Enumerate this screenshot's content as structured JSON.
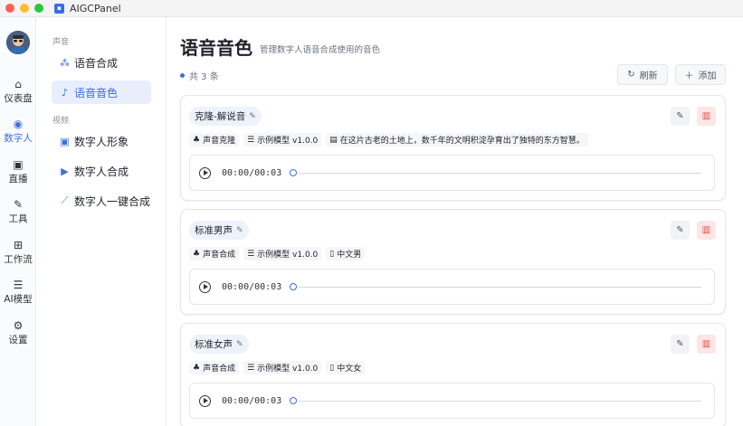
{
  "window": {
    "title": "AIGCPanel"
  },
  "rail": {
    "items": [
      {
        "label": "仪表盘",
        "icon": "home-icon"
      },
      {
        "label": "数字人",
        "icon": "user-circle-icon",
        "active": true
      },
      {
        "label": "直播",
        "icon": "tv-icon"
      },
      {
        "label": "工具",
        "icon": "wrench-icon"
      },
      {
        "label": "工作流",
        "icon": "workflow-icon"
      },
      {
        "label": "AI模型",
        "icon": "server-icon"
      },
      {
        "label": "设置",
        "icon": "gear-icon"
      }
    ]
  },
  "subnav": {
    "sections": [
      {
        "label": "声音",
        "items": [
          {
            "label": "语音合成",
            "icon": "waveform-icon"
          },
          {
            "label": "语音音色",
            "icon": "microphone-icon",
            "active": true
          }
        ]
      },
      {
        "label": "视频",
        "items": [
          {
            "label": "数字人形象",
            "icon": "portrait-icon"
          },
          {
            "label": "数字人合成",
            "icon": "video-icon"
          },
          {
            "label": "数字人一键合成",
            "icon": "magic-wand-icon"
          }
        ]
      }
    ]
  },
  "main": {
    "title": "语音音色",
    "subtitle": "管理数字人语音合成使用的音色",
    "count": "共 3 条",
    "refresh_label": "刷新",
    "add_label": "添加",
    "cards": [
      {
        "name": "克隆-解说音",
        "tags": [
          "声音克隆",
          "示例模型 v1.0.0",
          "在这片古老的土地上，数千年的文明积淀孕育出了独特的东方智慧。"
        ],
        "time": "00:00/00:03"
      },
      {
        "name": "标准男声",
        "tags": [
          "声音合成",
          "示例模型 v1.0.0",
          "中文男"
        ],
        "time": "00:00/00:03"
      },
      {
        "name": "标准女声",
        "tags": [
          "声音合成",
          "示例模型 v1.0.0",
          "中文女"
        ],
        "time": "00:00/00:03"
      }
    ]
  },
  "colors": {
    "accent": "#3b6fe0",
    "danger": "#e5484d"
  }
}
